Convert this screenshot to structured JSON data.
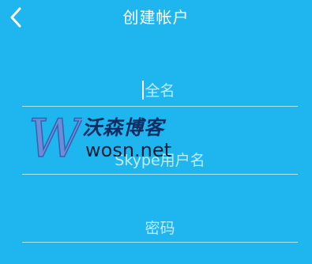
{
  "header": {
    "title": "创建帐户",
    "back_icon": "chevron-left-icon"
  },
  "form": {
    "fullname_placeholder": "全名",
    "skypename_placeholder": "Skype用户名",
    "password_placeholder": "密码"
  },
  "watermark": {
    "logo_letter": "W",
    "cn_text": "沃森博客",
    "en_text": "wosn.net"
  },
  "colors": {
    "background": "#1fb6ef",
    "text": "#ffffff"
  }
}
